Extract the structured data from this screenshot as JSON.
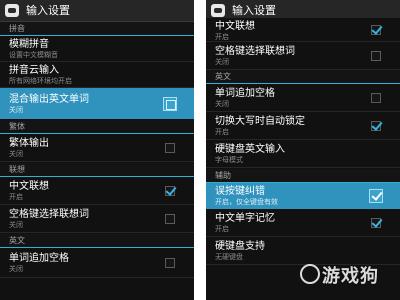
{
  "left": {
    "title": "输入设置",
    "rows": [
      {
        "kind": "header",
        "label": "拼音"
      },
      {
        "kind": "item",
        "title": "模糊拼音",
        "sub": "设置中文模糊音"
      },
      {
        "kind": "item",
        "title": "拼音云输入",
        "sub": "所有网络环境均开启"
      },
      {
        "kind": "item",
        "title": "混合输出英文单词",
        "sub": "关闭",
        "checkbox": "unchecked",
        "selected": true
      },
      {
        "kind": "header",
        "label": "繁体"
      },
      {
        "kind": "item",
        "title": "繁体输出",
        "sub": "关闭",
        "checkbox": "unchecked"
      },
      {
        "kind": "header",
        "label": "联想"
      },
      {
        "kind": "item",
        "title": "中文联想",
        "sub": "开启",
        "checkbox": "checked"
      },
      {
        "kind": "item",
        "title": "空格键选择联想词",
        "sub": "关闭",
        "checkbox": "unchecked"
      },
      {
        "kind": "header",
        "label": "英文"
      },
      {
        "kind": "item",
        "title": "单词追加空格",
        "sub": "关闭",
        "checkbox": "unchecked"
      }
    ]
  },
  "right": {
    "title": "输入设置",
    "rows": [
      {
        "kind": "item",
        "title": "中文联想",
        "sub": "开启",
        "checkbox": "checked"
      },
      {
        "kind": "item",
        "title": "空格键选择联想词",
        "sub": "关闭",
        "checkbox": "unchecked"
      },
      {
        "kind": "header",
        "label": "英文"
      },
      {
        "kind": "item",
        "title": "单词追加空格",
        "sub": "关闭",
        "checkbox": "unchecked"
      },
      {
        "kind": "item",
        "title": "切换大写时自动锁定",
        "sub": "开启",
        "checkbox": "checked"
      },
      {
        "kind": "item",
        "title": "硬键盘英文输入",
        "sub": "字母模式"
      },
      {
        "kind": "header",
        "label": "辅助"
      },
      {
        "kind": "item",
        "title": "误按键纠错",
        "sub": "开启，仅全键盘有效",
        "checkbox": "checked",
        "selected": true
      },
      {
        "kind": "item",
        "title": "中文单字记忆",
        "sub": "开启",
        "checkbox": "checked"
      },
      {
        "kind": "item",
        "title": "硬键盘支持",
        "sub": "无硬键盘"
      }
    ]
  },
  "watermark": "游戏狗",
  "colors": {
    "accent": "#33b5e5",
    "selected": "#2f93bd",
    "background": "#111111"
  }
}
